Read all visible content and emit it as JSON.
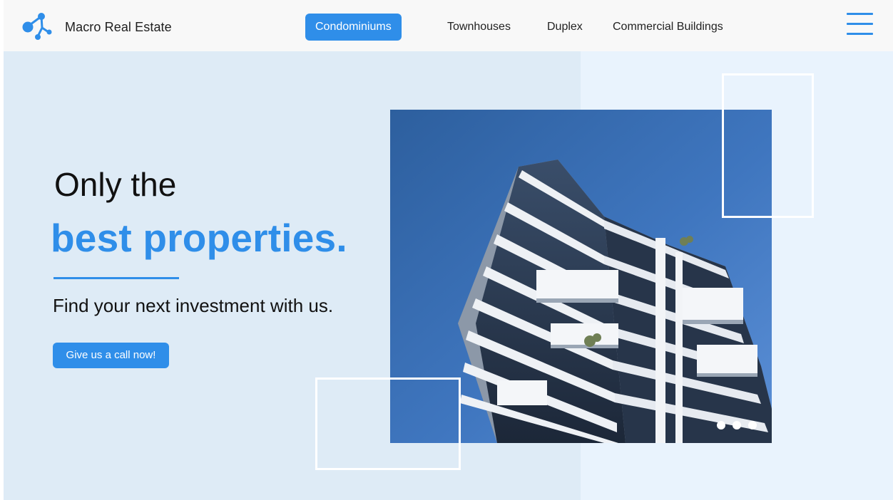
{
  "header": {
    "brand": "Macro Real Estate",
    "nav": [
      {
        "label": "Condominiums",
        "active": true
      },
      {
        "label": "Townhouses",
        "active": false
      },
      {
        "label": "Duplex",
        "active": false
      },
      {
        "label": "Commercial Buildings",
        "active": false
      }
    ],
    "menu_icon": "hamburger-menu-icon",
    "logo_icon": "molecule-logo-icon"
  },
  "hero": {
    "line1": "Only the",
    "line2": "best properties.",
    "subtitle": "Find your next investment with us.",
    "cta_label": "Give us a call now!",
    "image_icon": "building-photo"
  },
  "carousel": {
    "total": 3,
    "active_index": 0
  },
  "colors": {
    "accent": "#2f8ee9",
    "bg_left": "#deebf6",
    "bg_right": "#e9f3fd",
    "header_bg": "#f8f8f8"
  }
}
